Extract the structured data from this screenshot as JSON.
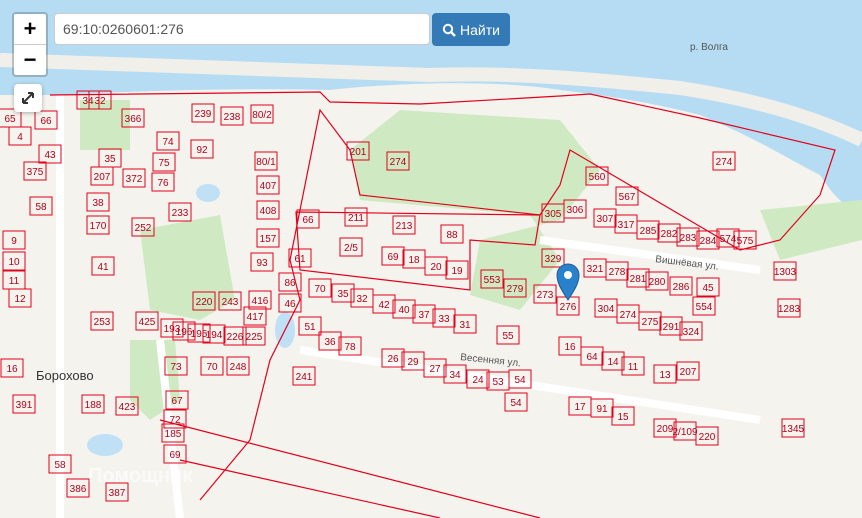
{
  "search": {
    "value": "69:10:0260601:276",
    "button_label": "Найти",
    "icon": "search-icon"
  },
  "controls": {
    "zoom_in": "+",
    "zoom_out": "−",
    "fullscreen_icon": "expand-icon"
  },
  "map": {
    "river_label": "р. Волга",
    "streets": [
      "Весенняя ул.",
      "Вишнёвая ул."
    ],
    "village": "Борохово",
    "watermark": "Помощник",
    "accent_color": "#e3001b",
    "parcels": [
      "32",
      "34",
      "366",
      "239",
      "238",
      "80/2",
      "65",
      "66",
      "74",
      "92",
      "201",
      "274",
      "274",
      "4",
      "43",
      "35",
      "75",
      "80/1",
      "375",
      "207",
      "372",
      "76",
      "407",
      "560",
      "567",
      "58",
      "38",
      "233",
      "408",
      "211",
      "213",
      "88",
      "305",
      "306",
      "307",
      "317",
      "285",
      "282",
      "283",
      "284",
      "574",
      "575",
      "9",
      "170",
      "252",
      "157",
      "66",
      "2/5",
      "69",
      "18",
      "20",
      "19",
      "329",
      "321",
      "278",
      "281",
      "280",
      "286",
      "45",
      "10",
      "41",
      "93",
      "61",
      "553",
      "279",
      "273",
      "276",
      "304",
      "274",
      "275",
      "291",
      "324",
      "554",
      "11",
      "12",
      "220",
      "243",
      "416",
      "86",
      "46",
      "70",
      "35",
      "32",
      "42",
      "40",
      "37",
      "33",
      "31",
      "55",
      "253",
      "425",
      "193",
      "196",
      "195",
      "194",
      "226",
      "225",
      "417",
      "51",
      "36",
      "78",
      "26",
      "29",
      "27",
      "34",
      "24",
      "53",
      "54",
      "16",
      "64",
      "14",
      "11",
      "13",
      "207",
      "16",
      "73",
      "70",
      "248",
      "241",
      "54",
      "17",
      "91",
      "15",
      "209",
      "2/109",
      "220",
      "391",
      "188",
      "423",
      "67",
      "72",
      "185",
      "69",
      "58",
      "386",
      "387",
      "1303",
      "1345",
      "1283"
    ]
  }
}
